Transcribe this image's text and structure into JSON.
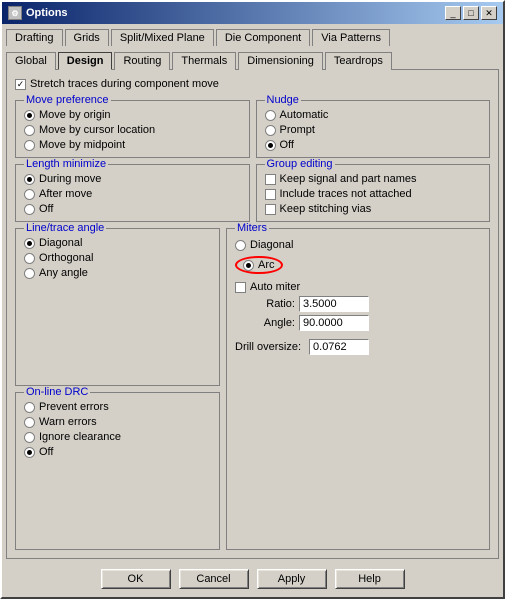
{
  "window": {
    "title": "Options",
    "icon": "⚙"
  },
  "tabs_row1": [
    {
      "label": "Drafting",
      "active": false
    },
    {
      "label": "Grids",
      "active": false
    },
    {
      "label": "Split/Mixed Plane",
      "active": false
    },
    {
      "label": "Die Component",
      "active": false
    },
    {
      "label": "Via Patterns",
      "active": false
    }
  ],
  "tabs_row2": [
    {
      "label": "Global",
      "active": false
    },
    {
      "label": "Design",
      "active": true
    },
    {
      "label": "Routing",
      "active": false
    },
    {
      "label": "Thermals",
      "active": false
    },
    {
      "label": "Dimensioning",
      "active": false
    },
    {
      "label": "Teardrops",
      "active": false
    }
  ],
  "stretch_traces": {
    "label": "Stretch traces during component move",
    "checked": true
  },
  "move_preference": {
    "title": "Move preference",
    "options": [
      {
        "label": "Move by origin",
        "checked": true
      },
      {
        "label": "Move by cursor location",
        "checked": false
      },
      {
        "label": "Move by midpoint",
        "checked": false
      }
    ]
  },
  "nudge": {
    "title": "Nudge",
    "options": [
      {
        "label": "Automatic",
        "checked": false
      },
      {
        "label": "Prompt",
        "checked": false
      },
      {
        "label": "Off",
        "checked": true
      }
    ]
  },
  "length_minimize": {
    "title": "Length minimize",
    "options": [
      {
        "label": "During move",
        "checked": true
      },
      {
        "label": "After move",
        "checked": false
      },
      {
        "label": "Off",
        "checked": false
      }
    ]
  },
  "group_editing": {
    "title": "Group editing",
    "options": [
      {
        "label": "Keep signal and part names",
        "checked": false
      },
      {
        "label": "Include traces not attached",
        "checked": false
      },
      {
        "label": "Keep stitching vias",
        "checked": false
      }
    ]
  },
  "line_trace_angle": {
    "title": "Line/trace angle",
    "options": [
      {
        "label": "Diagonal",
        "checked": true
      },
      {
        "label": "Orthogonal",
        "checked": false
      },
      {
        "label": "Any angle",
        "checked": false
      }
    ]
  },
  "miters": {
    "title": "Miters",
    "options": [
      {
        "label": "Diagonal",
        "checked": false
      },
      {
        "label": "Arc",
        "checked": true
      }
    ],
    "auto_miter": {
      "label": "Auto miter",
      "checked": false
    },
    "ratio": {
      "label": "Ratio:",
      "value": "3.5000"
    },
    "angle": {
      "label": "Angle:",
      "value": "90.0000"
    },
    "drill_oversize": {
      "label": "Drill oversize:",
      "value": "0.0762"
    }
  },
  "online_drc": {
    "title": "On-line DRC",
    "options": [
      {
        "label": "Prevent errors",
        "checked": false
      },
      {
        "label": "Warn errors",
        "checked": false
      },
      {
        "label": "Ignore clearance",
        "checked": false
      },
      {
        "label": "Off",
        "checked": true
      }
    ]
  },
  "footer": {
    "ok": "OK",
    "cancel": "Cancel",
    "apply": "Apply",
    "help": "Help"
  }
}
